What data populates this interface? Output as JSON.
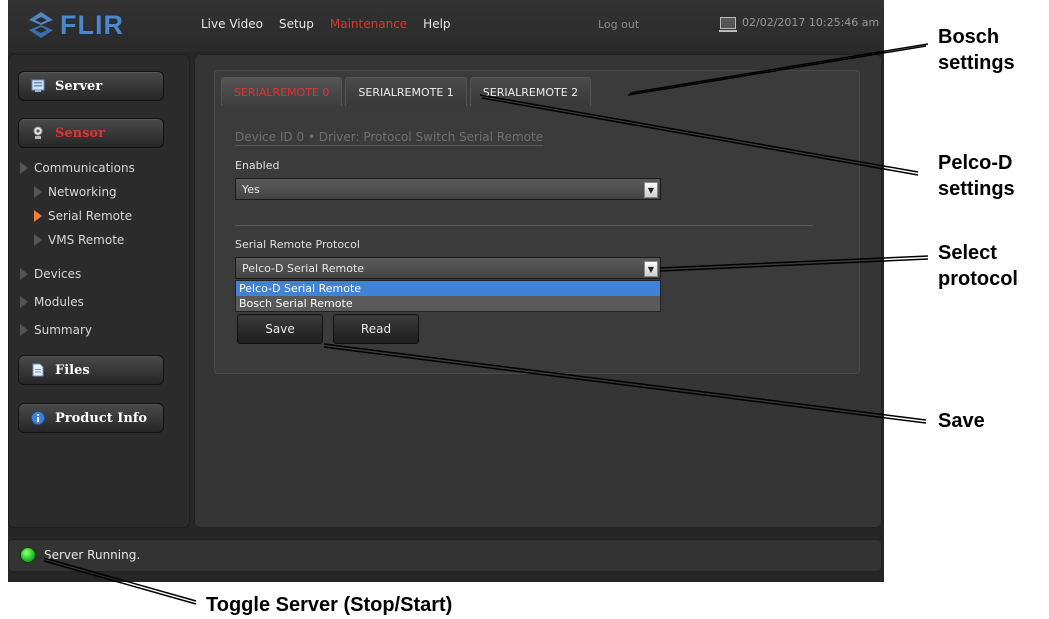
{
  "app": {
    "logo": "FLIR",
    "nav": [
      "Live Video",
      "Setup",
      "Maintenance",
      "Help"
    ],
    "active_nav": "Maintenance",
    "logout": "Log out",
    "datetime": "02/02/2017 10:25:46 am"
  },
  "sidebar": {
    "server": "Server",
    "sensor": "Sensor",
    "sensor_items": [
      "Communications",
      "Networking",
      "Serial Remote",
      "VMS Remote"
    ],
    "other_items": [
      "Devices",
      "Modules",
      "Summary"
    ],
    "files": "Files",
    "product_info": "Product Info",
    "active_item": "Serial Remote"
  },
  "tabs": [
    "SERIALREMOTE 0",
    "SERIALREMOTE 1",
    "SERIALREMOTE 2"
  ],
  "form": {
    "device_line": "Device ID 0  •  Driver: Protocol Switch Serial Remote",
    "enabled_label": "Enabled",
    "enabled_value": "Yes",
    "protocol_label": "Serial Remote Protocol",
    "protocol_value": "Pelco-D Serial Remote",
    "protocol_options": [
      "Pelco-D Serial Remote",
      "Bosch Serial Remote"
    ],
    "save": "Save",
    "read": "Read"
  },
  "status": {
    "text": "Server Running."
  },
  "callouts": {
    "bosch": "Bosch\nsettings",
    "pelco": "Pelco-D\nsettings",
    "select": "Select\nprotocol",
    "save": "Save",
    "toggle": "Toggle Server (Stop/Start)"
  },
  "colors": {
    "accent_red": "#e03232",
    "logo_blue": "#4f86c6",
    "select_blue": "#3f82d8",
    "led_green": "#2fd22f"
  }
}
